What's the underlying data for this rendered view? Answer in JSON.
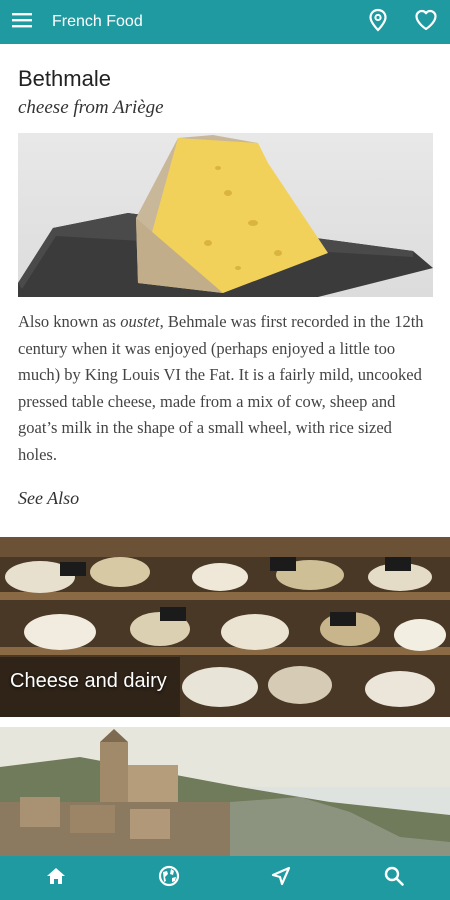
{
  "appbar": {
    "title": "French Food",
    "menu_icon": "menu-icon",
    "map_icon": "map-pin-icon",
    "favorite_icon": "heart-icon"
  },
  "article": {
    "title": "Bethmale",
    "subtitle": "cheese from Ariège",
    "body_before_em": "Also known as ",
    "body_em": "oustet",
    "body_after_em": ", Behmale was first recorded in the 12th century when it was enjoyed (perhaps enjoyed a little too much) by King Louis VI the Fat. It is a fairly mild, uncooked pressed table cheese, made from a mix of cow, sheep and goat’s milk in the shape of a small wheel, with rice sized holes.",
    "see_also": "See Also"
  },
  "related": [
    {
      "label": "Cheese and dairy"
    },
    {
      "label": ""
    }
  ],
  "bottom_nav": [
    {
      "icon": "home-icon"
    },
    {
      "icon": "globe-icon"
    },
    {
      "icon": "navigation-icon"
    },
    {
      "icon": "search-icon"
    }
  ],
  "colors": {
    "primary": "#1f9aa0",
    "text": "#444444"
  }
}
